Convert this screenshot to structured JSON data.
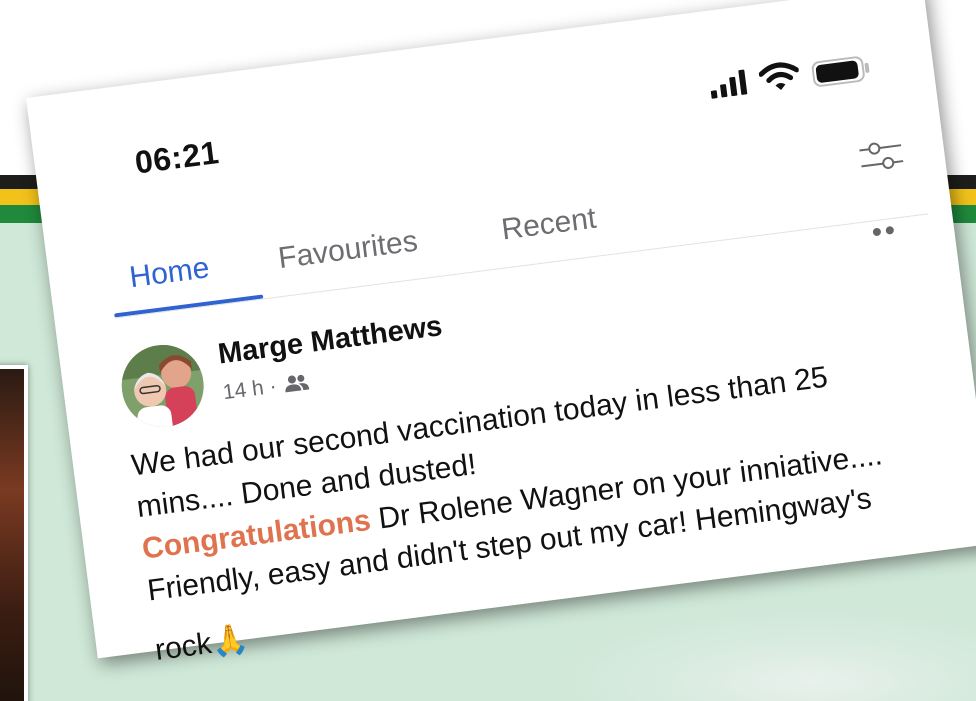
{
  "status_bar": {
    "time": "06:21"
  },
  "tabs": [
    {
      "label": "Home",
      "active": true
    },
    {
      "label": "Favourites",
      "active": false
    },
    {
      "label": "Recent",
      "active": false
    }
  ],
  "post": {
    "author": "Marge Matthews",
    "time_ago": "14 h",
    "separator": "·",
    "audience_icon": "friends-icon",
    "lines": [
      "We had our second vaccination today in less than 25",
      "mins.... Done and dusted!",
      "Dr Rolene Wagner on your inniative....",
      "Friendly, easy and didn't step out my car!   Hemingway's",
      "rock"
    ],
    "highlight_word": "Congratulations",
    "emoji": "🙏"
  },
  "colors": {
    "accent_blue": "#2f63d1",
    "highlight_orange": "#e0734f",
    "stripe_black": "#1d1d1b",
    "stripe_yellow": "#f2c21b",
    "stripe_green": "#1f8a3c",
    "background_mint": "#cfe8d7"
  }
}
